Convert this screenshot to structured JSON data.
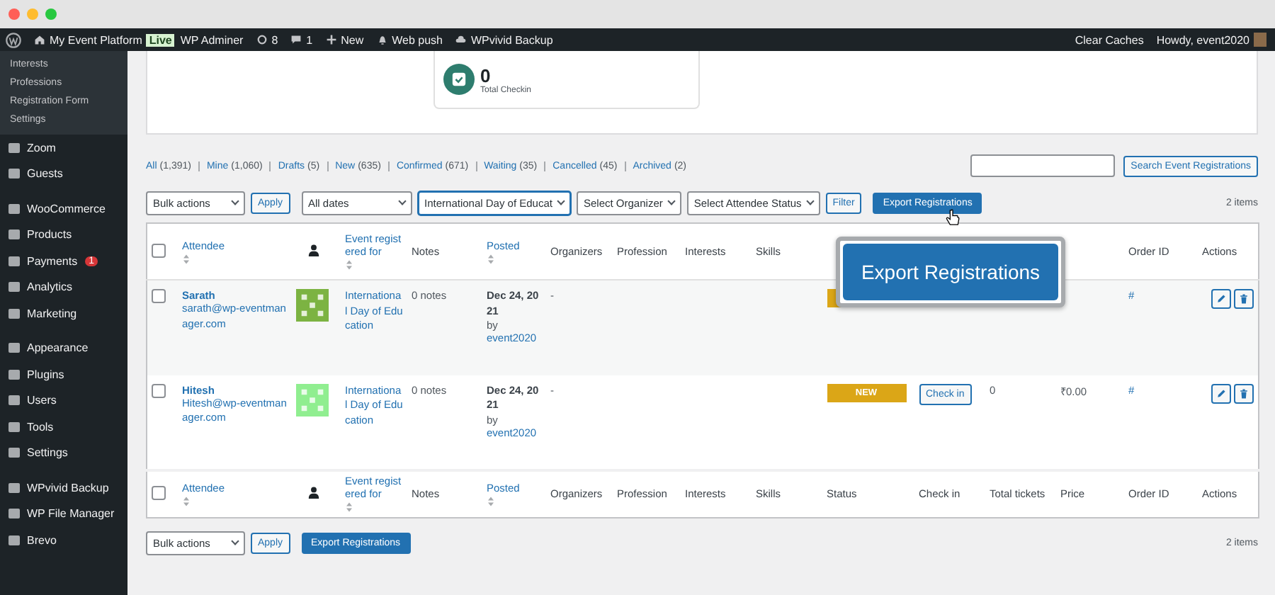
{
  "admin_bar": {
    "site": "My Event Platform",
    "live": "Live",
    "adminer": "WP Adminer",
    "updates": "8",
    "comments": "1",
    "new": "New",
    "web_push": "Web push",
    "backup": "WPvivid Backup",
    "clear_caches": "Clear Caches",
    "howdy": "Howdy, event2020"
  },
  "sidebar": {
    "submenu": [
      "Interests",
      "Professions",
      "Registration Form",
      "Settings"
    ],
    "groups": [
      {
        "items": [
          {
            "label": "Zoom"
          },
          {
            "label": "Guests"
          }
        ]
      },
      {
        "items": [
          {
            "label": "WooCommerce"
          },
          {
            "label": "Products"
          },
          {
            "label": "Payments",
            "badge": "1"
          },
          {
            "label": "Analytics"
          },
          {
            "label": "Marketing"
          }
        ]
      },
      {
        "items": [
          {
            "label": "Appearance"
          },
          {
            "label": "Plugins"
          },
          {
            "label": "Users"
          },
          {
            "label": "Tools"
          },
          {
            "label": "Settings"
          }
        ]
      },
      {
        "items": [
          {
            "label": "WPvivid Backup"
          },
          {
            "label": "WP File Manager"
          },
          {
            "label": "Brevo"
          }
        ]
      }
    ]
  },
  "stat_card": {
    "value": "0",
    "label": "Total Checkin"
  },
  "status_links": [
    {
      "label": "All",
      "count": "(1,391)"
    },
    {
      "label": "Mine",
      "count": "(1,060)"
    },
    {
      "label": "Drafts",
      "count": "(5)"
    },
    {
      "label": "New",
      "count": "(635)"
    },
    {
      "label": "Confirmed",
      "count": "(671)"
    },
    {
      "label": "Waiting",
      "count": "(35)"
    },
    {
      "label": "Cancelled",
      "count": "(45)"
    },
    {
      "label": "Archived",
      "count": "(2)"
    }
  ],
  "search": {
    "button": "Search Event Registrations"
  },
  "toolbar": {
    "bulk": "Bulk actions",
    "apply": "Apply",
    "dates": "All dates",
    "event": "International Day of Educat",
    "organizer": "Select Organizer",
    "attendee_status": "Select Attendee Status",
    "filter": "Filter",
    "export": "Export Registrations",
    "count": "2 items"
  },
  "table": {
    "header": [
      {
        "kind": "check",
        "checked": false
      },
      {
        "kind": "text",
        "label": "Attendee",
        "link": true,
        "sort": true
      },
      {
        "kind": "avatar"
      },
      {
        "kind": "text",
        "label": "Event registered for",
        "link": true,
        "sort": true
      },
      {
        "kind": "text",
        "label": "Notes"
      },
      {
        "kind": "text",
        "label": "Posted",
        "link": true,
        "sort": true
      },
      {
        "kind": "text",
        "label": "Organizers"
      },
      {
        "kind": "text",
        "label": "Profession"
      },
      {
        "kind": "text",
        "label": "Interests"
      },
      {
        "kind": "text",
        "label": "Skills"
      },
      {
        "kind": "blank"
      },
      {
        "kind": "blank"
      },
      {
        "kind": "blank"
      },
      {
        "kind": "blank"
      },
      {
        "kind": "text",
        "label": "Order ID"
      },
      {
        "kind": "text",
        "label": "Actions"
      }
    ],
    "footer": [
      {
        "kind": "check",
        "checked": false
      },
      {
        "kind": "text",
        "label": "Attendee",
        "link": true,
        "sort": true
      },
      {
        "kind": "avatar"
      },
      {
        "kind": "text",
        "label": "Event registered for",
        "link": true,
        "sort": true
      },
      {
        "kind": "text",
        "label": "Notes"
      },
      {
        "kind": "text",
        "label": "Posted",
        "link": true,
        "sort": true
      },
      {
        "kind": "text",
        "label": "Organizers"
      },
      {
        "kind": "text",
        "label": "Profession"
      },
      {
        "kind": "text",
        "label": "Interests"
      },
      {
        "kind": "text",
        "label": "Skills"
      },
      {
        "kind": "text",
        "label": "Status"
      },
      {
        "kind": "text",
        "label": "Check in"
      },
      {
        "kind": "text",
        "label": "Total tickets"
      },
      {
        "kind": "text",
        "label": "Price"
      },
      {
        "kind": "text",
        "label": "Order ID"
      },
      {
        "kind": "text",
        "label": "Actions"
      }
    ],
    "rows": [
      {
        "checked": false,
        "name": "Sarath",
        "email": "sarath@wp-eventmanager.com",
        "color": "#7cb342",
        "event": "International Day of Education",
        "notes": "0 notes",
        "date": "Dec 24, 2021",
        "by": "by",
        "author": "event2020",
        "organizers": "-",
        "order": "#"
      },
      {
        "checked": false,
        "name": "Hitesh",
        "email": "Hitesh@wp-eventmanager.com",
        "color": "#90ee90",
        "event": "International Day of Education",
        "notes": "0 notes",
        "date": "Dec 24, 2021",
        "by": "by",
        "author": "event2020",
        "organizers": "-",
        "status": "NEW",
        "checkin": "Check in",
        "tickets": "0",
        "price": "₹0.00",
        "order": "#"
      }
    ]
  },
  "bottom": {
    "bulk": "Bulk actions",
    "apply": "Apply",
    "export": "Export Registrations",
    "count": "2 items"
  },
  "callout": {
    "label": "Export Registrations"
  }
}
